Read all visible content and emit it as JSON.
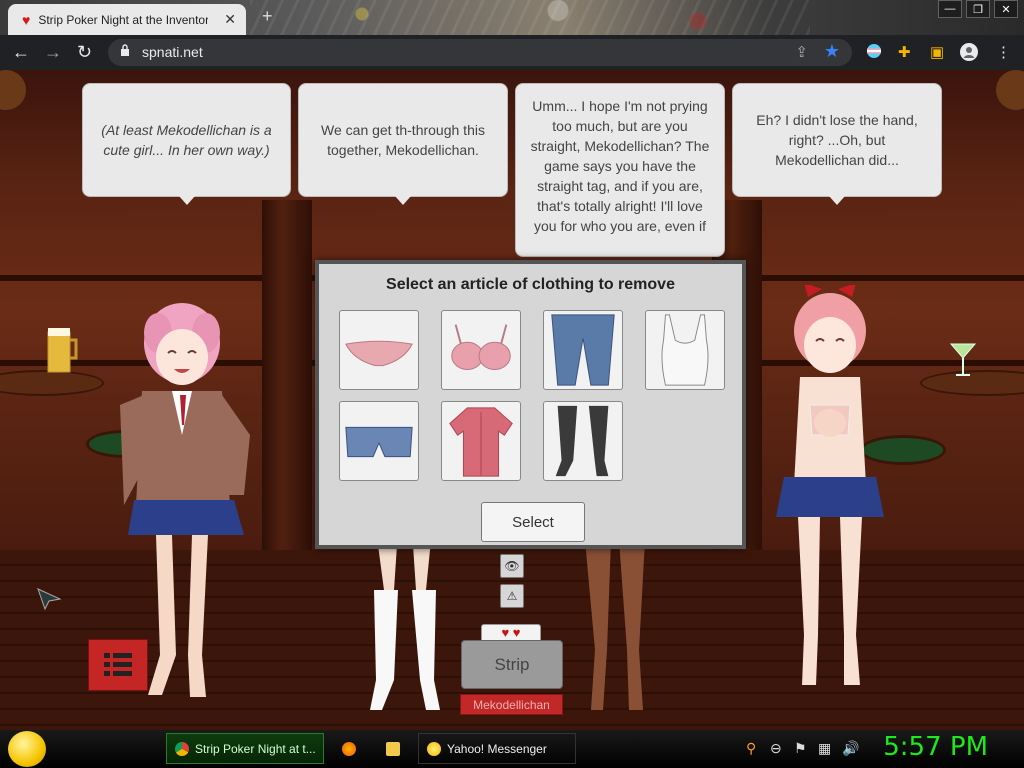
{
  "browser": {
    "tab_title": "Strip Poker Night at the Inventory",
    "tab_close": "✕",
    "new_tab": "+",
    "url": "spnati.net",
    "window_buttons": [
      "—",
      "❐",
      "✕"
    ]
  },
  "game": {
    "bubbles": [
      {
        "text": "(At least Mekodellichan is a cute girl... In her own way.)",
        "italic": true
      },
      {
        "text": "We can get th-through this together, Mekodellichan.",
        "italic": false
      },
      {
        "text": "Umm... I hope I'm not prying too much, but are you straight, Mekodellichan? The game says you have the straight tag, and if you are, that's totally alright! I'll love you for who you are, even if",
        "italic": false
      },
      {
        "text": "Eh? I didn't lose the hand, right? ...Oh, but Mekodellichan did...",
        "italic": false
      }
    ],
    "dialog": {
      "title": "Select an article of clothing to remove",
      "items": [
        {
          "name": "panties",
          "color": "#e8a8b0"
        },
        {
          "name": "bra",
          "color": "#e8a0ac"
        },
        {
          "name": "jeans",
          "color": "#5a7aa8"
        },
        {
          "name": "tank top",
          "color": "#f4f4f4"
        },
        {
          "name": "shorts",
          "color": "#6a86b4"
        },
        {
          "name": "shirt",
          "color": "#d86a78"
        },
        {
          "name": "stockings",
          "color": "#3a3a3a"
        }
      ],
      "select_label": "Select"
    },
    "card_text": "♥ ♥",
    "strip_label": "Strip",
    "player_name": "Mekodellichan"
  },
  "taskbar": {
    "tasks": [
      {
        "label": "Strip Poker Night at t...",
        "active": true
      },
      {
        "label": "",
        "active": false
      },
      {
        "label": "",
        "active": false
      },
      {
        "label": "Yahoo! Messenger",
        "active": false
      }
    ],
    "clock": "5:57 PM"
  }
}
